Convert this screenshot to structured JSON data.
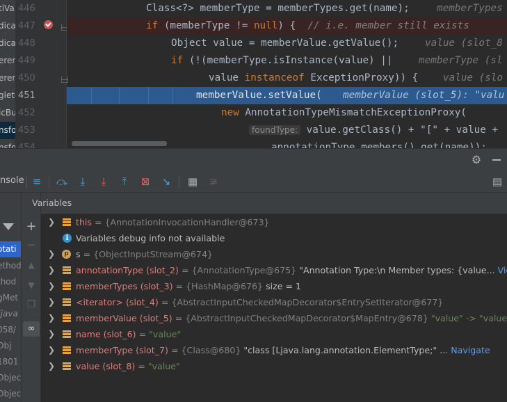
{
  "editor": {
    "left_panel_items": [
      "tiVa",
      "dica",
      "dica",
      "eren",
      "eren",
      "gleto",
      "icBu",
      "nsfo",
      "nsfo",
      "nsfo"
    ],
    "lines": [
      {
        "num": "446"
      },
      {
        "num": "447"
      },
      {
        "num": "448"
      },
      {
        "num": "449"
      },
      {
        "num": "450"
      },
      {
        "num": "451"
      },
      {
        "num": "452"
      },
      {
        "num": "453"
      },
      {
        "num": "454"
      }
    ],
    "code": {
      "l446_a": "Class<?> memberType = memberTypes.get(name);",
      "l446_hint": "memberTypes",
      "l447_kw": "if",
      "l447_a": " (memberType != ",
      "l447_null": "null",
      "l447_b": ") {  ",
      "l447_cm": "// i.e. member still exists",
      "l448_a": "Object value = memberValue.getValue();",
      "l448_hint": "value (slot_8",
      "l449_kw": "if",
      "l449_a": " (!(memberType.isInstance(value) ||",
      "l449_hint": "memberType (sl",
      "l450_a": "value ",
      "l450_kw": "instanceof",
      "l450_b": " ExceptionProxy)) {",
      "l450_hint": "value (slo",
      "l451_a": "memberValue.setValue(",
      "l451_hint": "memberValue (slot_5): \"valu",
      "l452_kw": "new",
      "l452_a": " AnnotationTypeMismatchExceptionProxy(",
      "l453_param": "foundType:",
      "l453_a": " value.getClass() + \"[\" + value +",
      "l454_a": "annotationType.members().get(name));"
    }
  },
  "debug": {
    "console_tab": "nsole",
    "variables_header": "Variables",
    "frames": [
      "otati",
      "ethod",
      "thod",
      "gMet",
      "(java",
      "058/",
      "Obj",
      "1801",
      "Object",
      "Objec"
    ],
    "variables": [
      {
        "name": "this",
        "value": " = {AnnotationInvocationHandler@673}",
        "icon": "field"
      },
      {
        "name": "",
        "value": "Variables debug info not available",
        "icon": "info"
      },
      {
        "name": "s",
        "value": " = {ObjectInputStream@674}",
        "icon": "param"
      },
      {
        "name": "annotationType (slot_2)",
        "ref": " = {AnnotationType@675} ",
        "extra": "\"Annotation Type:\\n   Member types: {value...",
        "link": " View",
        "icon": "field"
      },
      {
        "name": "memberTypes (slot_3)",
        "ref": " = {HashMap@676} ",
        "extra": " size = 1",
        "icon": "field"
      },
      {
        "name": "<iterator> (slot_4)",
        "ref": " = {AbstractInputCheckedMapDecorator$EntrySetIterator@677}",
        "icon": "field"
      },
      {
        "name": "memberValue (slot_5)",
        "ref": " = {AbstractInputCheckedMapDecorator$MapEntry@678} ",
        "str": "\"value\" -> \"value\"",
        "icon": "field"
      },
      {
        "name": "name (slot_6)",
        "ref": " = ",
        "str": "\"value\"",
        "icon": "field"
      },
      {
        "name": "memberType (slot_7)",
        "ref": " = {Class@680} ",
        "extra": "\"class [Ljava.lang.annotation.ElementType;\" ...",
        "link": " Navigate",
        "icon": "field"
      },
      {
        "name": "value (slot_8)",
        "ref": " = ",
        "str": "\"value\"",
        "icon": "field"
      }
    ]
  }
}
